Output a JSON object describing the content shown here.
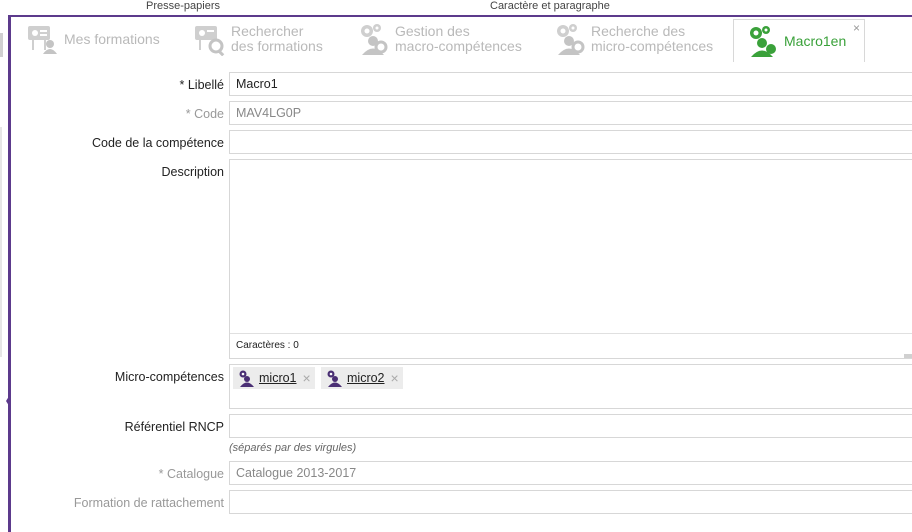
{
  "ribbon": {
    "group1": "Presse-papiers",
    "group2": "Caractère et paragraphe"
  },
  "tabs": [
    {
      "line1": "Mes formations",
      "line2": "",
      "icon": "formation-board-icon"
    },
    {
      "line1": "Rechercher",
      "line2": "des formations",
      "icon": "formation-search-icon"
    },
    {
      "line1": "Gestion des",
      "line2": "macro-compétences",
      "icon": "gears-person-icon"
    },
    {
      "line1": "Recherche des",
      "line2": "micro-compétences",
      "icon": "gears-search-icon"
    },
    {
      "line1": "Macro1en",
      "line2": "",
      "icon": "gears-person-icon",
      "close": "×"
    }
  ],
  "form": {
    "libelle": {
      "label": "* Libellé",
      "value": "Macro1"
    },
    "code": {
      "label": "* Code",
      "value": "MAV4LG0P"
    },
    "code_competence": {
      "label": "Code de la compétence",
      "value": ""
    },
    "description": {
      "label": "Description",
      "value": "",
      "char_count": "Caractères : 0"
    },
    "micro": {
      "label": "Micro-compétences",
      "items": [
        {
          "label": "micro1",
          "remove": "×"
        },
        {
          "label": "micro2",
          "remove": "×"
        }
      ]
    },
    "rncp": {
      "label": "Référentiel RNCP",
      "value": "",
      "hint": "(séparés par des virgules)"
    },
    "catalogue": {
      "label": "* Catalogue",
      "value": "Catalogue 2013-2017"
    },
    "rattachement": {
      "label": "Formation de rattachement",
      "value": ""
    }
  },
  "colors": {
    "accent": "#5c3a8c",
    "active_tab": "#3aa13a",
    "inactive": "#b9b9b9"
  }
}
